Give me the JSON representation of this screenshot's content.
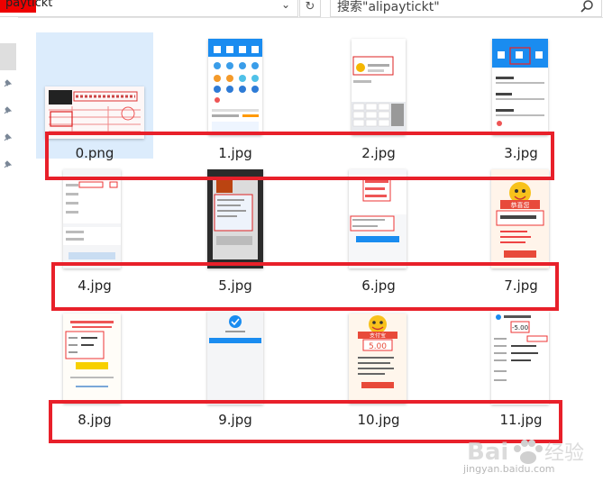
{
  "window": {
    "address_fragment": "paytickt",
    "search_placeholder": "搜索\"alipaytickt\""
  },
  "files": [
    {
      "name": "0.png",
      "selected": true
    },
    {
      "name": "1.jpg",
      "selected": false
    },
    {
      "name": "2.jpg",
      "selected": false
    },
    {
      "name": "3.jpg",
      "selected": false
    },
    {
      "name": "4.jpg",
      "selected": false
    },
    {
      "name": "5.jpg",
      "selected": false
    },
    {
      "name": "6.jpg",
      "selected": false
    },
    {
      "name": "7.jpg",
      "selected": false
    },
    {
      "name": "8.jpg",
      "selected": false
    },
    {
      "name": "9.jpg",
      "selected": false
    },
    {
      "name": "10.jpg",
      "selected": false
    },
    {
      "name": "11.jpg",
      "selected": false
    }
  ],
  "thumbs": {
    "t7_title": "恭喜您",
    "t10_title": "支付宝",
    "t10_amount": "5.00",
    "t11_amount": "-5.00"
  },
  "watermark": {
    "logo": "Bai百经验",
    "url": "jingyan.baidu.com"
  },
  "colors": {
    "highlight": "#e8202a",
    "selection": "#dcecfc",
    "alipay_blue": "#1a8cf0"
  }
}
